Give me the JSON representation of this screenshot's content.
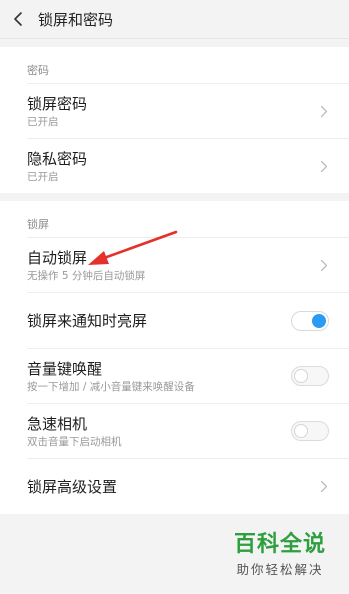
{
  "header": {
    "title": "锁屏和密码"
  },
  "sections": [
    {
      "title": "密码",
      "rows": [
        {
          "main": "锁屏密码",
          "sub": "已开启"
        },
        {
          "main": "隐私密码",
          "sub": "已开启"
        }
      ]
    },
    {
      "title": "锁屏",
      "rows": [
        {
          "main": "自动锁屏",
          "sub": "无操作 5 分钟后自动锁屏"
        },
        {
          "main": "锁屏来通知时亮屏",
          "toggle": "on"
        },
        {
          "main": "音量键唤醒",
          "sub": "按一下增加 / 减小音量键来唤醒设备",
          "toggle": "off"
        },
        {
          "main": "急速相机",
          "sub": "双击音量下启动相机",
          "toggle": "off"
        },
        {
          "main": "锁屏高级设置"
        }
      ]
    }
  ],
  "watermark": {
    "main": "百科全说",
    "sub": "助你轻松解决"
  },
  "colors": {
    "toggle_on": "#2b9af3",
    "annotation_arrow": "#e4312b",
    "watermark_green": "#2e9f3e"
  },
  "icons": {
    "back": "chevron-left-icon",
    "row_arrow": "chevron-right-icon"
  }
}
